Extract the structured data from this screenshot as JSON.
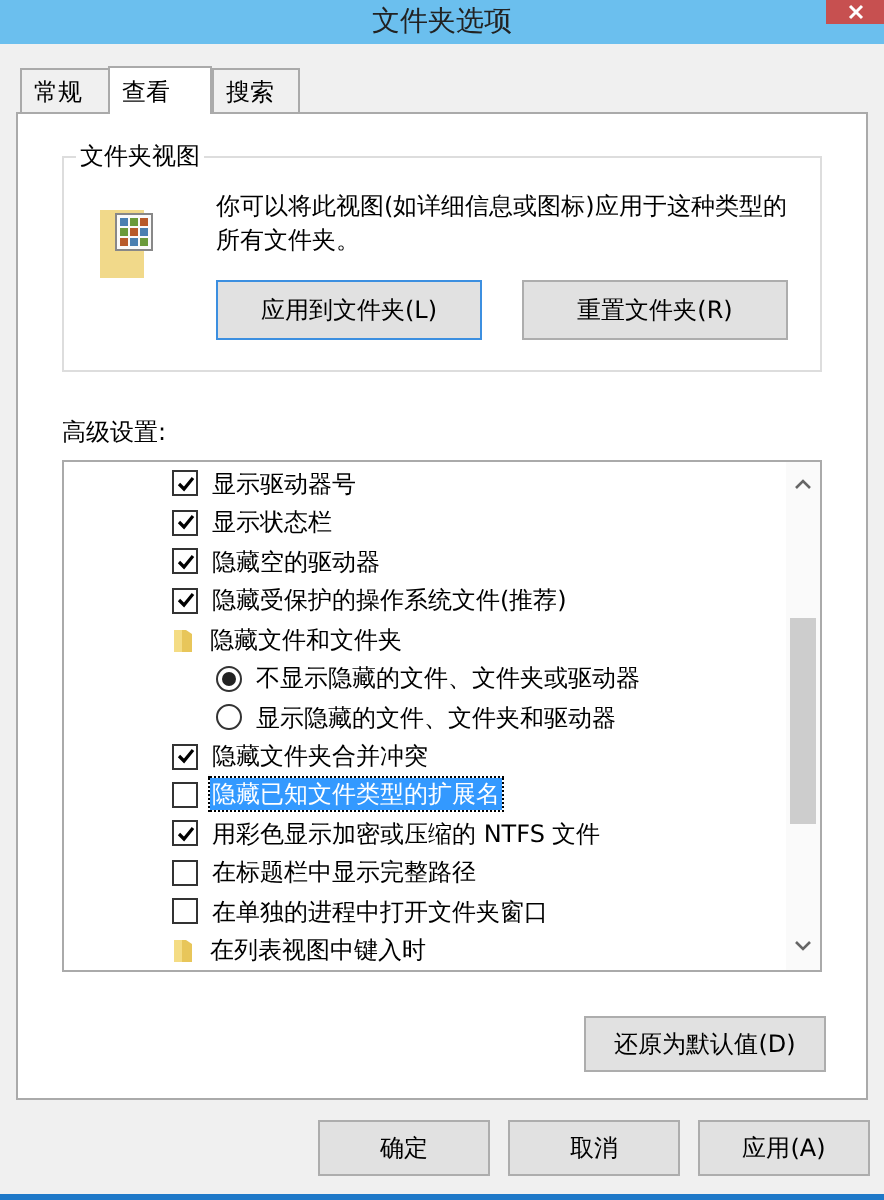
{
  "window": {
    "title": "文件夹选项"
  },
  "tabs": [
    {
      "label": "常规",
      "selected": false
    },
    {
      "label": "查看",
      "selected": true
    },
    {
      "label": "搜索",
      "selected": false
    }
  ],
  "folder_views": {
    "title": "文件夹视图",
    "description": "你可以将此视图(如详细信息或图标)应用于这种类型的所有文件夹。",
    "buttons": [
      {
        "label": "应用到文件夹(L)",
        "focused": true
      },
      {
        "label": "重置文件夹(R)",
        "focused": false
      }
    ]
  },
  "advanced": {
    "label": "高级设置:",
    "items": [
      {
        "kind": "checkbox",
        "label": "显示驱动器号",
        "checked": true,
        "selected": false
      },
      {
        "kind": "checkbox",
        "label": "显示状态栏",
        "checked": true,
        "selected": false
      },
      {
        "kind": "checkbox",
        "label": "隐藏空的驱动器",
        "checked": true,
        "selected": false
      },
      {
        "kind": "checkbox",
        "label": "隐藏受保护的操作系统文件(推荐)",
        "checked": true,
        "selected": false
      },
      {
        "kind": "folder",
        "label": "隐藏文件和文件夹",
        "selected": false
      },
      {
        "kind": "radio",
        "label": "不显示隐藏的文件、文件夹或驱动器",
        "checked": true,
        "selected": false
      },
      {
        "kind": "radio",
        "label": "显示隐藏的文件、文件夹和驱动器",
        "checked": false,
        "selected": false
      },
      {
        "kind": "checkbox",
        "label": "隐藏文件夹合并冲突",
        "checked": true,
        "selected": false
      },
      {
        "kind": "checkbox",
        "label": "隐藏已知文件类型的扩展名",
        "checked": false,
        "selected": true
      },
      {
        "kind": "checkbox",
        "label": "用彩色显示加密或压缩的 NTFS 文件",
        "checked": true,
        "selected": false
      },
      {
        "kind": "checkbox",
        "label": "在标题栏中显示完整路径",
        "checked": false,
        "selected": false
      },
      {
        "kind": "checkbox",
        "label": "在单独的进程中打开文件夹窗口",
        "checked": false,
        "selected": false
      },
      {
        "kind": "folder",
        "label": "在列表视图中键入时",
        "selected": false
      }
    ],
    "restore_button": "还原为默认值(D)"
  },
  "buttons": [
    {
      "label": "确定"
    },
    {
      "label": "取消"
    },
    {
      "label": "应用(A)"
    }
  ]
}
